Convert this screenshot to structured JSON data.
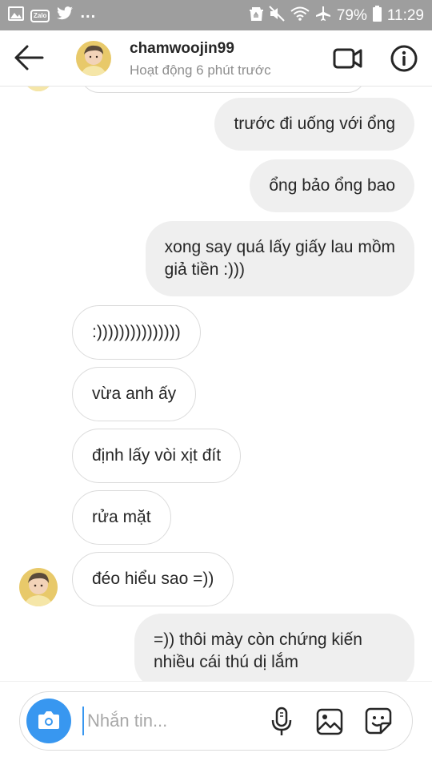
{
  "status_bar": {
    "zalo_label": "Zalo",
    "more_dots": "...",
    "battery": "79%",
    "time": "11:29"
  },
  "header": {
    "username": "chamwoojin99",
    "activity": "Hoạt động 6 phút trước"
  },
  "messages": [
    {
      "side": "sent",
      "text": "trước đi uống với ổng"
    },
    {
      "side": "sent",
      "text": "ổng bảo ổng bao"
    },
    {
      "side": "sent",
      "line1": "xong say quá lấy giấy lau mồm",
      "line2": "giả tiền :)))"
    },
    {
      "side": "received",
      "text": ":)))))))))))))))"
    },
    {
      "side": "received",
      "text": "vừa anh ấy"
    },
    {
      "side": "received",
      "text": "định lấy vòi xịt đít"
    },
    {
      "side": "received",
      "text": "rửa mặt"
    },
    {
      "side": "received",
      "text": "đéo hiểu sao =))"
    },
    {
      "side": "sent",
      "line1": "=)) thôi mày còn chứng kiến",
      "line2": "nhiều cái thú dị lắm"
    }
  ],
  "composer": {
    "placeholder": "Nhắn tin..."
  },
  "colors": {
    "status_bar": "#9e9e9e",
    "sent_bubble": "#efefef",
    "received_border": "#dbdbdb",
    "accent_blue": "#3897f0",
    "secondary_text": "#8e8e8e"
  },
  "icons": {
    "status_left": [
      "gallery-icon",
      "zalo-icon",
      "twitter-icon"
    ],
    "status_right": [
      "recycle-icon",
      "mute-icon",
      "wifi-icon",
      "airplane-icon",
      "battery-icon"
    ],
    "header": [
      "back-arrow-icon",
      "video-call-icon",
      "info-icon"
    ],
    "composer": [
      "camera-icon",
      "microphone-icon",
      "gallery-icon",
      "sticker-icon"
    ]
  }
}
